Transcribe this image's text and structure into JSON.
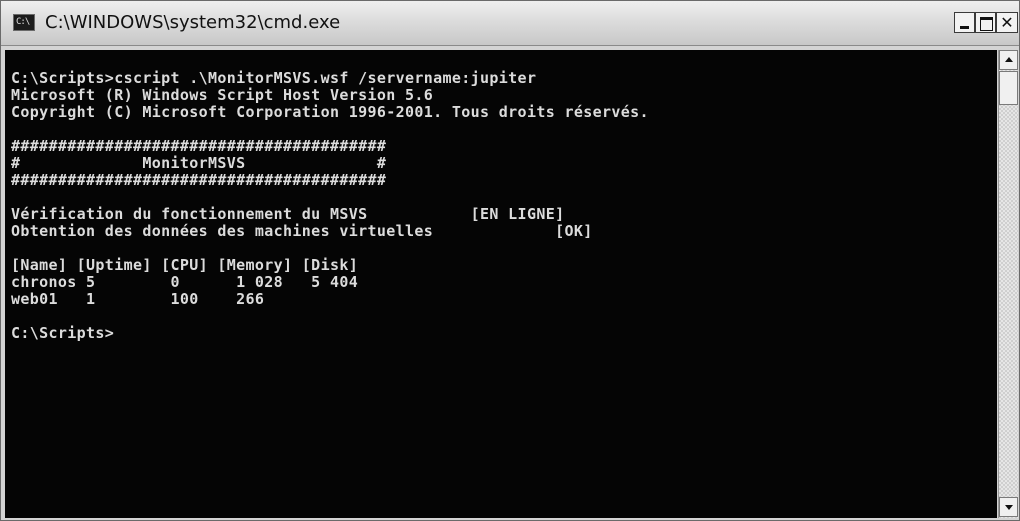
{
  "window": {
    "title": "C:\\WINDOWS\\system32\\cmd.exe",
    "icon": "cmd-icon",
    "icon_glyph": "C:\\"
  },
  "controls": {
    "minimize_icon": "minimize-icon",
    "maximize_icon": "maximize-icon",
    "close_icon": "close-icon",
    "close_glyph": "✕"
  },
  "console": {
    "background": "#050505",
    "foreground": "#dcdcdc",
    "lines": [
      "C:\\Scripts>cscript .\\MonitorMSVS.wsf /servername:jupiter",
      "Microsoft (R) Windows Script Host Version 5.6",
      "Copyright (C) Microsoft Corporation 1996-2001. Tous droits réservés.",
      "",
      "########################################",
      "#             MonitorMSVS              #",
      "########################################",
      "",
      "Vérification du fonctionnement du MSVS           [EN LIGNE]",
      "Obtention des données des machines virtuelles             [OK]",
      "",
      "[Name] [Uptime] [CPU] [Memory] [Disk]",
      "chronos 5        0      1 028   5 404",
      "web01   1        100    266",
      "",
      "C:\\Scripts>"
    ]
  },
  "scrollbar": {
    "up_icon": "scroll-up-arrow-icon",
    "down_icon": "scroll-down-arrow-icon",
    "position": 0
  }
}
